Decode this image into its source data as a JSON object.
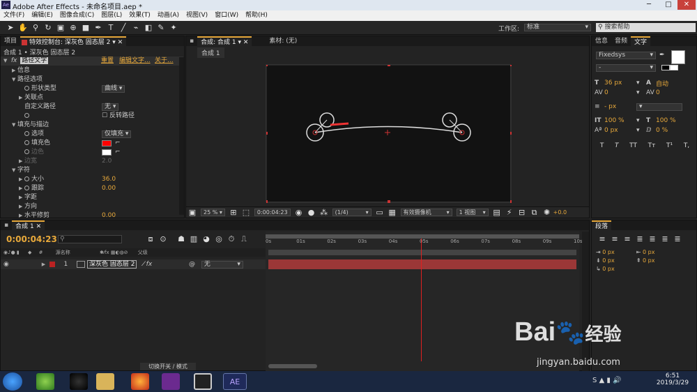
{
  "window": {
    "title": "Adobe After Effects - 未命名项目.aep *",
    "app_icon": "Ae"
  },
  "menu": [
    "文件(F)",
    "编辑(E)",
    "图像合成(C)",
    "图层(L)",
    "效果(T)",
    "动画(A)",
    "视图(V)",
    "窗口(W)",
    "帮助(H)"
  ],
  "toolbar": {
    "workspace_label": "工作区:",
    "workspace_value": "标准",
    "search_placeholder": "搜索帮助"
  },
  "left_panel": {
    "tabs": [
      "项目",
      "特效控制台: 深灰色 固态层 2"
    ],
    "breadcrumb": "合成 1 • 深灰色 固态层 2",
    "effect_name": "路径文字",
    "reset": "重置",
    "edit_text": "编辑文字...",
    "about": "关于...",
    "props": [
      {
        "label": "信息",
        "indent": 1,
        "tri": true
      },
      {
        "label": "路径选项",
        "indent": 1,
        "tri": true,
        "open": true
      },
      {
        "label": "形状类型",
        "indent": 2,
        "sw": true,
        "value": "曲线",
        "dd": true
      },
      {
        "label": "关联点",
        "indent": 2,
        "tri": true
      },
      {
        "label": "自定义路径",
        "indent": 2,
        "value": "无",
        "dd": true
      },
      {
        "label": "",
        "indent": 2,
        "sw": true,
        "check": "反转路径"
      },
      {
        "label": "填充与描边",
        "indent": 1,
        "tri": true,
        "open": true
      },
      {
        "label": "选项",
        "indent": 2,
        "sw": true,
        "value": "仅填充",
        "dd": true
      },
      {
        "label": "填充色",
        "indent": 2,
        "sw": true,
        "color": "#ff0000"
      },
      {
        "label": "边色",
        "indent": 2,
        "sw": true,
        "color": "#ffffff",
        "dim": true
      },
      {
        "label": "边宽",
        "indent": 2,
        "tri": true,
        "value": "2.0",
        "dim": true
      },
      {
        "label": "字符",
        "indent": 1,
        "tri": true,
        "open": true
      },
      {
        "label": "大小",
        "indent": 2,
        "tri": true,
        "sw": true,
        "value": "36.0",
        "orange": true
      },
      {
        "label": "跟踪",
        "indent": 2,
        "tri": true,
        "sw": true,
        "value": "0.00",
        "orange": true
      },
      {
        "label": "字距",
        "indent": 2,
        "tri": true
      },
      {
        "label": "方向",
        "indent": 2,
        "tri": true
      },
      {
        "label": "水平修剪",
        "indent": 2,
        "tri": true,
        "value": "0.00",
        "orange": true
      }
    ]
  },
  "comp_panel": {
    "tabs": [
      "合成: 合成 1",
      "素材: (无)"
    ],
    "subtab": "合成 1",
    "bottom": {
      "zoom": "25 %",
      "time": "0:00:04:23",
      "res": "(1/4)",
      "camera": "有效摄像机",
      "views": "1 视图",
      "exposure": "+0.0"
    }
  },
  "right_panel": {
    "tabs": [
      "信息",
      "音频",
      "文字"
    ],
    "font": "Fixedsys",
    "style": "-",
    "size": "36 px",
    "leading": "自动",
    "kerning": "0",
    "tracking": "0",
    "indent_unit": "- px",
    "vscale": "100 %",
    "hscale": "100 %",
    "baseline": "0 px",
    "tsume": "0 %",
    "styles": [
      "T",
      "T",
      "TT",
      "Tт",
      "T¹",
      "T,"
    ]
  },
  "timeline": {
    "tab": "合成 1",
    "time": "0:00:04:23",
    "search_placeholder": "",
    "col_source": "源名称",
    "col_parent": "父级",
    "layer": {
      "num": "1",
      "name": "深灰色 固态层 2",
      "parent": "无"
    },
    "ruler": [
      "0s",
      "01s",
      "02s",
      "03s",
      "04s",
      "05s",
      "06s",
      "07s",
      "08s",
      "09s",
      "10s"
    ],
    "playhead_seconds": 4.96,
    "duration_seconds": 10,
    "bottom_label": "切换开关 / 模式"
  },
  "paragraph": {
    "tab": "段落",
    "values": [
      "0 px",
      "0 px",
      "0 px",
      "0 px",
      "0 px"
    ]
  },
  "watermark": {
    "brand": "Bai",
    "brand2": "经验",
    "url": "jingyan.baidu.com"
  },
  "taskbar": {
    "time": "6:51",
    "date": "2019/3/29",
    "ae_label": "AE"
  }
}
